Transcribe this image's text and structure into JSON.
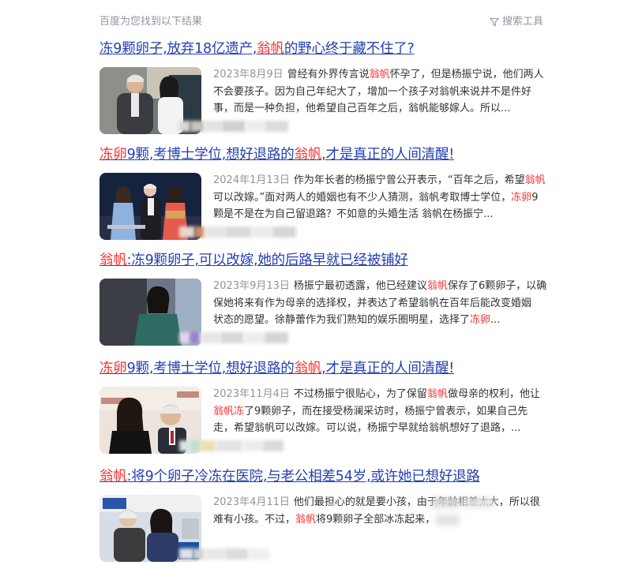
{
  "header": {
    "found_text": "百度为您找到以下结果",
    "tools_label": "搜索工具"
  },
  "results": [
    {
      "title": [
        {
          "t": "冻9颗卵子,放弃18亿遗产,",
          "hl": false
        },
        {
          "t": "翁帆",
          "hl": true
        },
        {
          "t": "的野心终于藏不住了?",
          "hl": false
        }
      ],
      "date": "2023年8月9日",
      "lines": [
        [
          {
            "t": "曾经有外界传言说",
            "hl": false
          },
          {
            "t": "翁帆",
            "hl": true
          },
          {
            "t": "怀孕了，但是杨振宁说，他们两人",
            "hl": false
          }
        ],
        [
          {
            "t": "不会要孩子。因为自己年纪大了，增加一个孩子对翁帆来说并不是件好",
            "hl": false
          }
        ],
        [
          {
            "t": "事，而是一种负担，他希望自己百年之后，翁帆能够嫁人。所以...",
            "hl": false
          }
        ]
      ]
    },
    {
      "title": [
        {
          "t": "冻卵",
          "hl": true
        },
        {
          "t": "9颗,考博士学位,想好退路的",
          "hl": false
        },
        {
          "t": "翁帆",
          "hl": true
        },
        {
          "t": ",才是真正的人间清醒!",
          "hl": false
        }
      ],
      "date": "2024年1月13日",
      "lines": [
        [
          {
            "t": "作为年长者的杨振宁曾公开表示，“百年之后，希望",
            "hl": false
          },
          {
            "t": "翁帆",
            "hl": true
          }
        ],
        [
          {
            "t": "可以改嫁。”面对两人的婚姻也有不少人猜测，翁帆考取博士学位，",
            "hl": false
          },
          {
            "t": "冻卵",
            "hl": true
          },
          {
            "t": "9",
            "hl": false
          }
        ],
        [
          {
            "t": "颗是不是在为自己留退路？不如意的头婚生活 翁帆在杨振宁...",
            "hl": false
          }
        ]
      ]
    },
    {
      "title": [
        {
          "t": "翁帆",
          "hl": true
        },
        {
          "t": ":冻9颗卵子,可以改嫁,她的后路早就已经被铺好",
          "hl": false
        }
      ],
      "date": "2023年9月13日",
      "lines": [
        [
          {
            "t": "杨振宁最初透露，他已经建议",
            "hl": false
          },
          {
            "t": "翁帆",
            "hl": true
          },
          {
            "t": "保存了6颗卵子，以确",
            "hl": false
          }
        ],
        [
          {
            "t": "保她将来有作为母亲的选择权，并表达了希望翁帆在百年后能改变婚姻",
            "hl": false
          }
        ],
        [
          {
            "t": "状态的愿望。徐静蕾作为我们熟知的娱乐圈明星，选择了",
            "hl": false
          },
          {
            "t": "冻卵",
            "hl": true
          },
          {
            "t": "...",
            "hl": false
          }
        ]
      ]
    },
    {
      "title": [
        {
          "t": "冻卵",
          "hl": true
        },
        {
          "t": "9颗,考博士学位,想好退路的",
          "hl": false
        },
        {
          "t": "翁帆",
          "hl": true
        },
        {
          "t": ",才是真正的人间清醒!",
          "hl": false
        }
      ],
      "date": "2023年11月4日",
      "lines": [
        [
          {
            "t": "不过杨振宁很贴心，为了保留",
            "hl": false
          },
          {
            "t": "翁帆",
            "hl": true
          },
          {
            "t": "做母亲的权利，他让",
            "hl": false
          }
        ],
        [
          {
            "t": "翁帆冻",
            "hl": true
          },
          {
            "t": "了9颗卵子，而在接受杨澜采访时，杨振宁曾表示，如果自己先",
            "hl": false
          }
        ],
        [
          {
            "t": "走，希望翁帆可以改嫁。可以说，杨振宁早就给翁帆想好了退路，...",
            "hl": false
          }
        ]
      ]
    },
    {
      "title": [
        {
          "t": "翁帆",
          "hl": true
        },
        {
          "t": ":将9个卵子冷冻在医院,与老公相差54岁,或许她已想好退路",
          "hl": false
        }
      ],
      "date": "2023年4月11日",
      "lines": [
        [
          {
            "t": "他们最担心的就是要小孩，由于年龄相差太大，所以很",
            "hl": false
          }
        ],
        [
          {
            "t": "难有小孩。不过，",
            "hl": false
          },
          {
            "t": "翁帆",
            "hl": true
          },
          {
            "t": "将9颗卵子全部冰冻起来，",
            "hl": false
          }
        ]
      ]
    }
  ]
}
